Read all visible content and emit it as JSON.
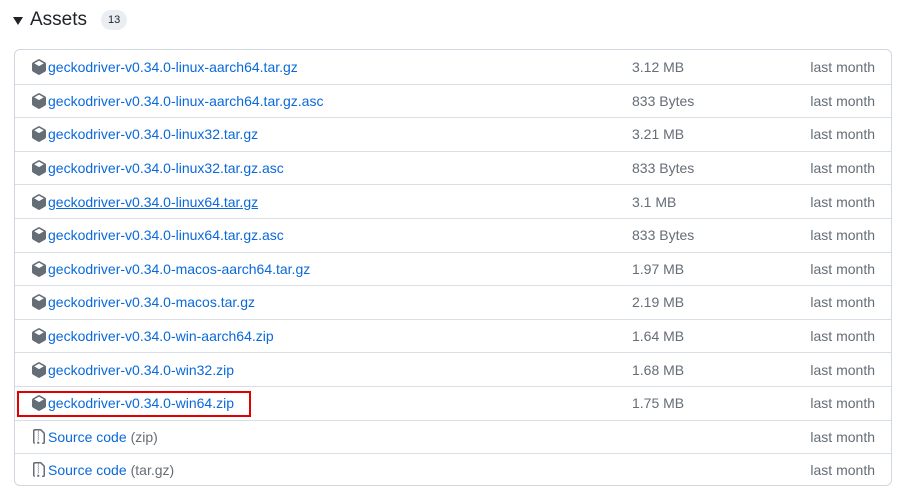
{
  "header": {
    "title": "Assets",
    "count": "13"
  },
  "assets": [
    {
      "name": "geckodriver-v0.34.0-linux-aarch64.tar.gz",
      "size": "3.12 MB",
      "time": "last month",
      "icon": "package-icon"
    },
    {
      "name": "geckodriver-v0.34.0-linux-aarch64.tar.gz.asc",
      "size": "833 Bytes",
      "time": "last month",
      "icon": "package-icon"
    },
    {
      "name": "geckodriver-v0.34.0-linux32.tar.gz",
      "size": "3.21 MB",
      "time": "last month",
      "icon": "package-icon"
    },
    {
      "name": "geckodriver-v0.34.0-linux32.tar.gz.asc",
      "size": "833 Bytes",
      "time": "last month",
      "icon": "package-icon"
    },
    {
      "name": "geckodriver-v0.34.0-linux64.tar.gz",
      "size": "3.1 MB",
      "time": "last month",
      "icon": "package-icon",
      "hovered": true
    },
    {
      "name": "geckodriver-v0.34.0-linux64.tar.gz.asc",
      "size": "833 Bytes",
      "time": "last month",
      "icon": "package-icon"
    },
    {
      "name": "geckodriver-v0.34.0-macos-aarch64.tar.gz",
      "size": "1.97 MB",
      "time": "last month",
      "icon": "package-icon"
    },
    {
      "name": "geckodriver-v0.34.0-macos.tar.gz",
      "size": "2.19 MB",
      "time": "last month",
      "icon": "package-icon"
    },
    {
      "name": "geckodriver-v0.34.0-win-aarch64.zip",
      "size": "1.64 MB",
      "time": "last month",
      "icon": "package-icon"
    },
    {
      "name": "geckodriver-v0.34.0-win32.zip",
      "size": "1.68 MB",
      "time": "last month",
      "icon": "package-icon"
    },
    {
      "name": "geckodriver-v0.34.0-win64.zip",
      "size": "1.75 MB",
      "time": "last month",
      "icon": "package-icon",
      "highlighted": true
    }
  ],
  "sources": [
    {
      "label": "Source code",
      "sub": "(zip)",
      "time": "last month",
      "icon": "file-zip-icon"
    },
    {
      "label": "Source code",
      "sub": "(tar.gz)",
      "time": "last month",
      "icon": "file-zip-icon"
    }
  ],
  "colors": {
    "link": "#0969da",
    "muted": "#656d76",
    "border": "#d0d7de",
    "highlight": "#e00000"
  }
}
